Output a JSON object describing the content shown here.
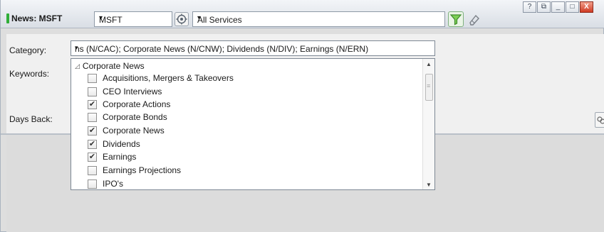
{
  "header": {
    "title": "News: MSFT",
    "symbol": "MSFT",
    "services": "All Services",
    "caret": "▾",
    "window_buttons": [
      "?",
      "⧉",
      "_",
      "□",
      "X"
    ]
  },
  "form": {
    "category_label": "Category:",
    "keywords_label": "Keywords:",
    "days_back_label": "Days Back:",
    "category_value": "ns (N/CAC); Corporate News (N/CNW); Dividends (N/DIV); Earnings (N/ERN)"
  },
  "dropdown": {
    "group": "Corporate News",
    "items": [
      {
        "label": "Acquisitions, Mergers & Takeovers",
        "checked": false
      },
      {
        "label": "CEO Interviews",
        "checked": false
      },
      {
        "label": "Corporate Actions",
        "checked": true
      },
      {
        "label": "Corporate Bonds",
        "checked": false
      },
      {
        "label": "Corporate News",
        "checked": true
      },
      {
        "label": "Dividends",
        "checked": true
      },
      {
        "label": "Earnings",
        "checked": true
      },
      {
        "label": "Earnings Projections",
        "checked": false
      },
      {
        "label": "IPO's",
        "checked": false
      }
    ]
  },
  "colors": {
    "accent_green": "#2fae38",
    "close_red": "#cf3a23"
  },
  "icons": {
    "refresh": "gear-icon",
    "filter": "filter-icon",
    "clear": "eraser-icon"
  }
}
